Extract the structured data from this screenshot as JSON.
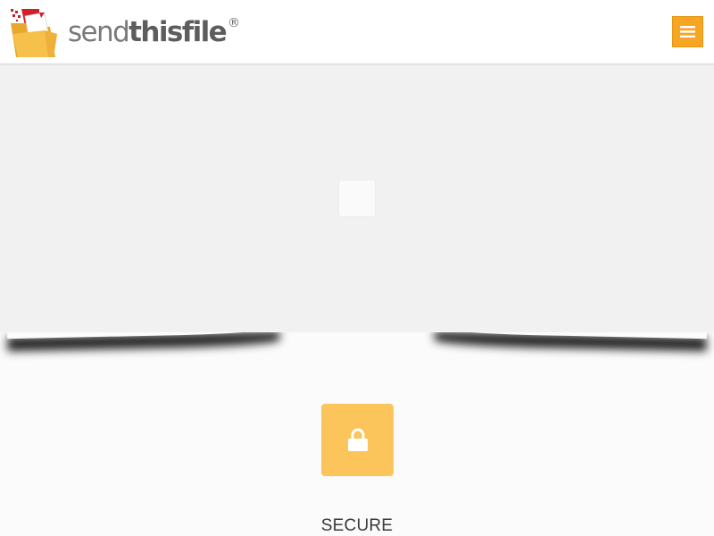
{
  "header": {
    "logo": {
      "text_light": "send",
      "text_bold": "thisfile",
      "registered_mark": "®",
      "icon": "folder-logo-icon"
    },
    "menu_button": {
      "icon": "hamburger-menu-icon"
    }
  },
  "hero": {
    "placeholder_icon": "loading-placeholder-icon"
  },
  "features": [
    {
      "icon": "lock-icon",
      "title": "SECURE"
    }
  ],
  "colors": {
    "accent": "#f6a623",
    "feature_tile": "#fcc55b",
    "hero_background": "#f1f1f1",
    "logo_red": "#d0202a"
  }
}
